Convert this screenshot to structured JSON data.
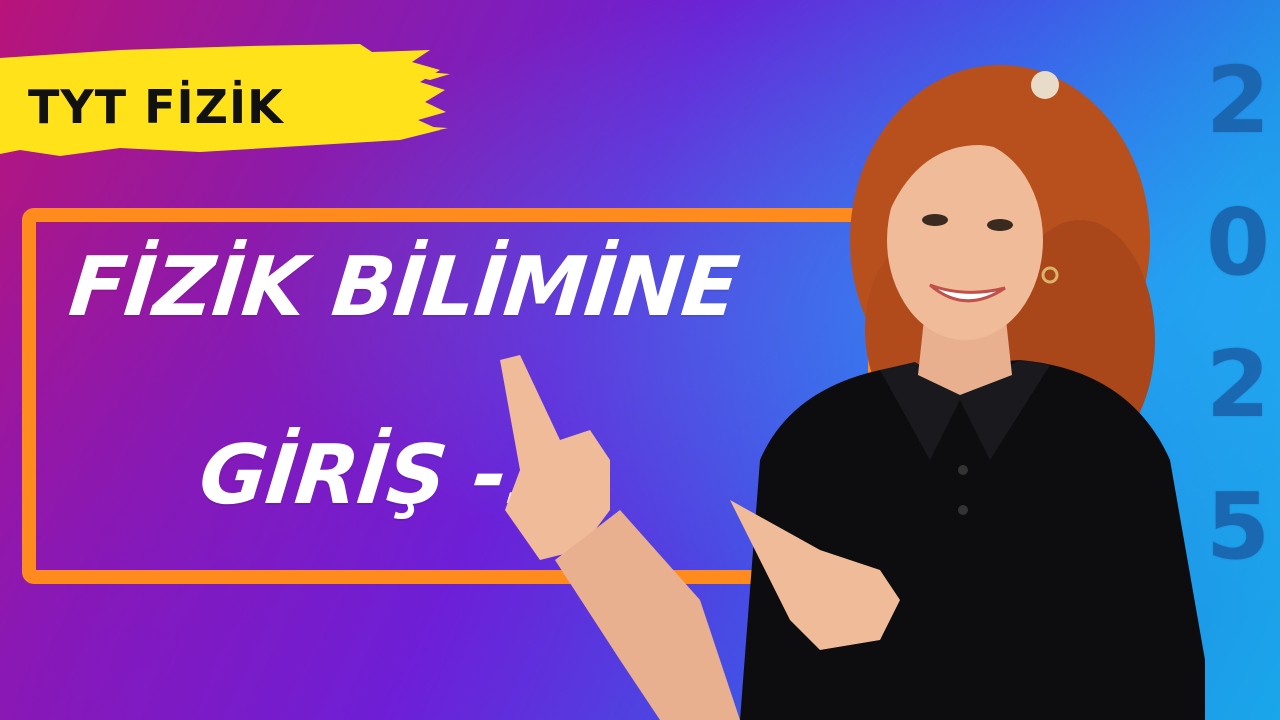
{
  "badge": {
    "label": "TYT FİZİK"
  },
  "title": {
    "line1": "FİZİK BİLİMİNE",
    "line2": "GİRİŞ -1"
  },
  "year": {
    "digits": [
      "2",
      "0",
      "2",
      "5"
    ]
  },
  "colors": {
    "badge_yellow": "#ffe21a",
    "frame_orange": "#ff8a1e",
    "title_text": "#ffffff",
    "year_blue": "#1a5fa8"
  }
}
